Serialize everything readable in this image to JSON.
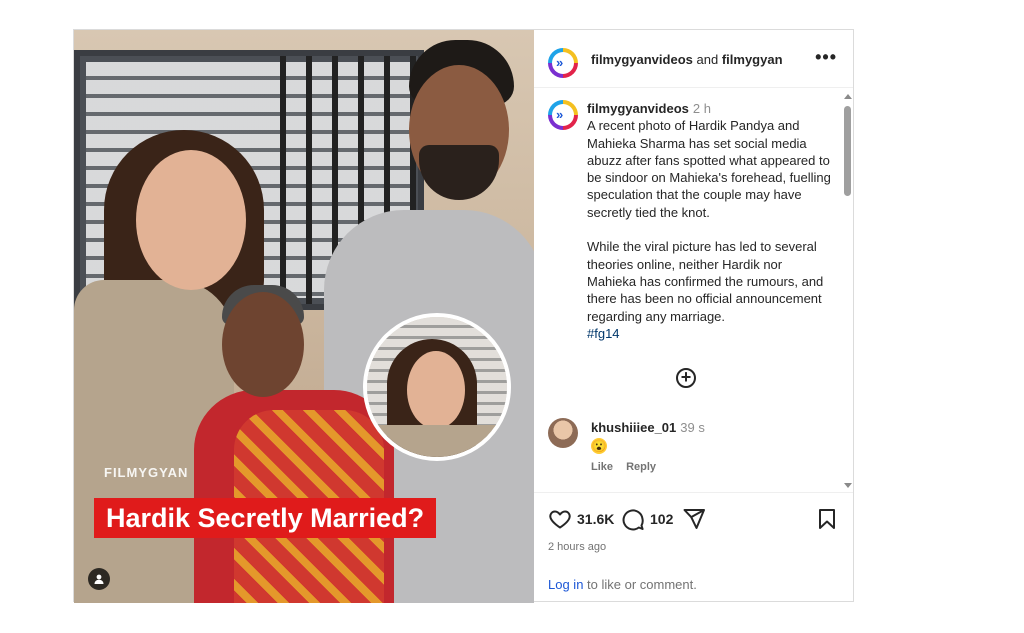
{
  "header": {
    "account1": "filmygyanvideos",
    "joiner": "and",
    "account2": "filmygyan",
    "more_icon": "more-horizontal-icon"
  },
  "media": {
    "watermark": "FILMYGYAN",
    "headline": "Hardik Secretly Married?",
    "user_tag_icon": "person-tag-icon",
    "headline_color": "#e01b1b"
  },
  "caption": {
    "username": "filmygyanvideos",
    "time": "2 h",
    "paragraph1": "A recent photo of Hardik Pandya and Mahieka Sharma has set social media abuzz after fans spotted what appeared to be sindoor on Mahieka's forehead, fuelling speculation that the couple may have secretly tied the knot.",
    "paragraph2": "While the viral picture has led to several theories online, neither Hardik nor Mahieka has confirmed the rumours, and there has been no official announcement regarding any marriage.",
    "hashtag": "#fg14"
  },
  "load_more_icon": "plus-circle-icon",
  "comment": {
    "username": "khushiiiee_01",
    "time": "39 s",
    "emoji": "😮",
    "like_label": "Like",
    "reply_label": "Reply"
  },
  "stats": {
    "likes": "31.6K",
    "comments": "102",
    "posted": "2 hours ago"
  },
  "login": {
    "link_text": "Log in",
    "rest_text": "to like or comment."
  },
  "colors": {
    "link": "#1c57d6",
    "muted": "#737373",
    "text": "#262626"
  }
}
